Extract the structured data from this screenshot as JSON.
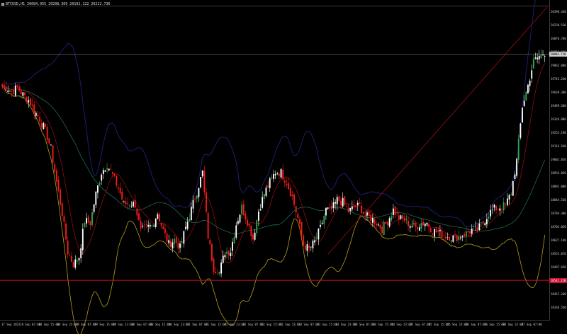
{
  "header": {
    "symbol_line": "BTCUSD,H1  20084.955 20208.369 20102.122 20222.736"
  },
  "price_axis": {
    "ticks": [
      "20396.430",
      "20238.530",
      "20070.760",
      "19915.680",
      "19862.080",
      "19745.240",
      "19638.300",
      "19499.500",
      "19326.000",
      "19253.190",
      "19116.540",
      "19002.850",
      "18934.050",
      "18891.000",
      "18844.530",
      "18794.300",
      "18704.820",
      "18627.140",
      "18553.870",
      "18497.650",
      "18431.300",
      "18412.240",
      "18336.550"
    ],
    "current_price": "20094.738",
    "reference_level": "18542.150",
    "current_tag_color": "#cfcfcf",
    "reference_tag_color": "#c8102e"
  },
  "time_axis": {
    "labels": [
      "17 Sep 2022",
      "18 Sep 07:00",
      "18 Sep 15:00",
      "18 Sep 23:00",
      "19 Sep 07:00",
      "19 Sep 15:00",
      "19 Sep 23:00",
      "20 Sep 07:00",
      "20 Sep 15:00",
      "20 Sep 23:00",
      "21 Sep 07:00",
      "21 Sep 15:00",
      "21 Sep 23:00",
      "22 Sep 07:00",
      "22 Sep 15:00",
      "22 Sep 23:00",
      "23 Sep 07:00",
      "23 Sep 15:00",
      "23 Sep 23:00",
      "24 Sep 07:00",
      "24 Sep 15:00",
      "24 Sep 23:00",
      "25 Sep 07:00",
      "25 Sep 15:00",
      "25 Sep 23:00",
      "26 Sep 07:00",
      "26 Sep 15:00",
      "26 Sep 23:00",
      "27 Sep 07:00"
    ]
  },
  "colors": {
    "background": "#000000",
    "bull_candle": "#ffffff",
    "bear_candle": "#ff1a1a",
    "bull_alt": "#2ea84a",
    "bands_outer": "#1c1f6e",
    "band_inner": "#1f6b4e",
    "ma_red": "#8b0e0e",
    "ma_yellow": "#b5a21a",
    "trendline": "#9b1010",
    "hline_ref": "#c8102e",
    "hline_current": "#bdbdbd"
  },
  "chart": {
    "closes": [
      19872,
      19840,
      19867,
      19818,
      19781,
      19708,
      19652,
      19569,
      19446,
      19218,
      19005,
      18736,
      18651,
      18705,
      18952,
      18936,
      19136,
      19285,
      19340,
      19263,
      19176,
      19065,
      19073,
      19063,
      18878,
      18903,
      18918,
      19004,
      18884,
      18791,
      18821,
      18765,
      18904,
      19029,
      19153,
      19284,
      18844,
      18624,
      18598,
      18737,
      18744,
      18928,
      19043,
      18949,
      18829,
      19020,
      19139,
      19216,
      19287,
      19285,
      19214,
      19114,
      18966,
      18786,
      18756,
      18807,
      18900,
      19027,
      19025,
      19095,
      19079,
      19015,
      19043,
      19055,
      18983,
      18971,
      18938,
      18896,
      18950,
      19026,
      18969,
      18954,
      18924,
      18905,
      18937,
      18937,
      18883,
      18871,
      18851,
      18844,
      18833,
      18850,
      18864,
      18889,
      18891,
      18938,
      19001,
      19033,
      19047,
      19057,
      19146,
      19364,
      19738,
      19882,
      20047,
      20083,
      20108
    ],
    "price_max": 20420,
    "price_min": 18280,
    "trend_start_index": 58,
    "trend_start_price": 18720
  }
}
